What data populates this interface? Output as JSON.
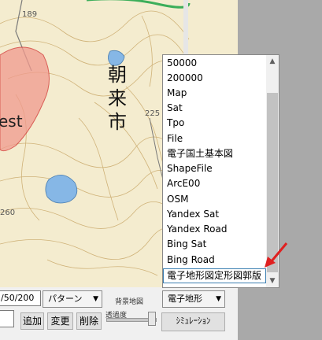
{
  "map": {
    "labels": [
      "189",
      "225",
      "260"
    ],
    "place_kanji": "朝来市",
    "place_latin": "est"
  },
  "controls": {
    "scale_input_value": "/50/200",
    "pattern_combo": "パターン",
    "background_map_label": "背景地図",
    "background_combo_value": "電子地形",
    "transparency_label": "透過度",
    "add_button": "追加",
    "change_button": "変更",
    "delete_button": "削除",
    "simulation_button": "ｼﾐｭﾚｰｼｮﾝ"
  },
  "dropdown": {
    "options": [
      "50000",
      "200000",
      "Map",
      "Sat",
      "Tpo",
      "File",
      "電子国土基本図",
      "ShapeFile",
      "ArcE00",
      "OSM",
      "Yandex Sat",
      "Yandex Road",
      "Bing Sat",
      "Bing Road",
      "電子地形図定形図郭版"
    ],
    "selected_option": "電子地形図定形図郭版"
  },
  "colors": {
    "map_background": "#f4eccf",
    "contour": "#c9a86a",
    "road_green": "#3cae5a",
    "highlight_red": "#f19a8e",
    "water": "#86b7e6",
    "arrow": "#e02020"
  },
  "icons": {
    "combo_arrow": "chevron-down-icon",
    "annotation_arrow": "red-arrow-icon"
  }
}
